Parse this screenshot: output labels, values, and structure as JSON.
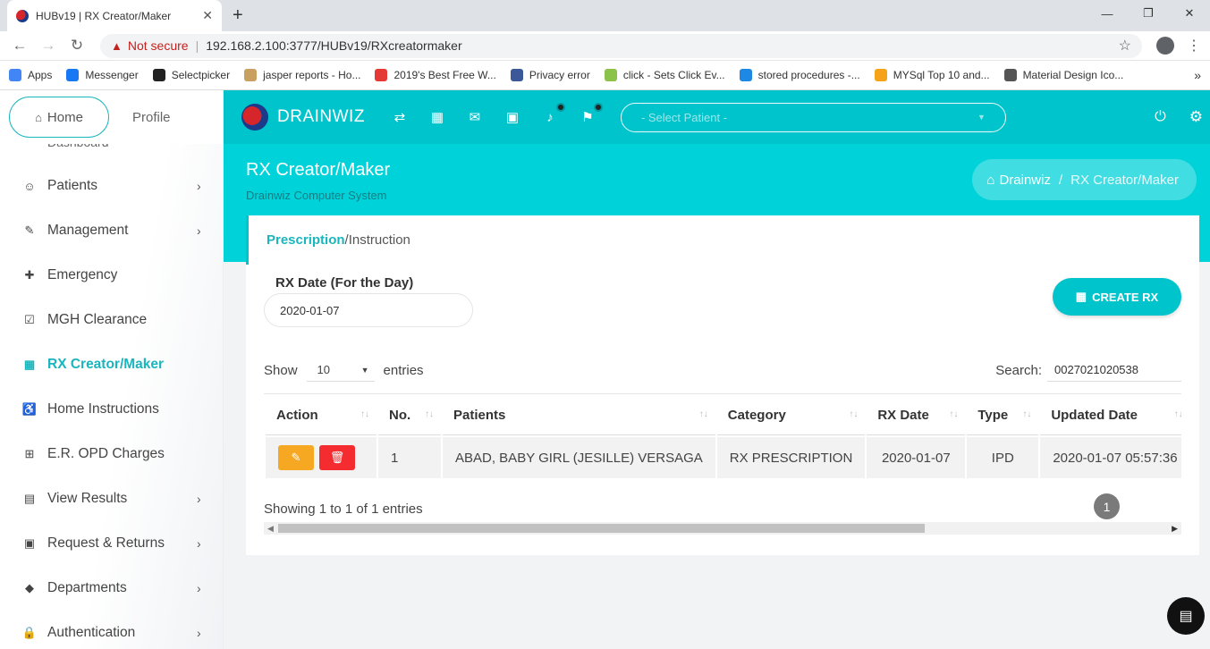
{
  "browser": {
    "tab_title": "HUBv19 | RX Creator/Maker",
    "tab_close": "✕",
    "new_tab": "+",
    "security_label": "Not secure",
    "url": "192.168.2.100:3777/HUBv19/RXcreatormaker",
    "bookmarks": [
      {
        "label": "Apps",
        "color": "#4285f4"
      },
      {
        "label": "Messenger",
        "color": "#1877f2"
      },
      {
        "label": "Selectpicker",
        "color": "#222222"
      },
      {
        "label": "jasper reports - Ho...",
        "color": "#c8a060"
      },
      {
        "label": "2019's Best Free W...",
        "color": "#e53935"
      },
      {
        "label": "Privacy error",
        "color": "#3b5998"
      },
      {
        "label": "click - Sets Click Ev...",
        "color": "#8bc34a"
      },
      {
        "label": "stored procedures -...",
        "color": "#1e88e5"
      },
      {
        "label": "MYSql Top 10 and...",
        "color": "#f4a31a"
      },
      {
        "label": "Material Design Ico...",
        "color": "#555555"
      }
    ],
    "bookmarks_more": "»"
  },
  "sidebar": {
    "home_tab": "Home",
    "profile_tab": "Profile",
    "cut_label": "Dashboard",
    "items": [
      {
        "label": "Patients",
        "icon": "☺",
        "chevron": "›",
        "active": false
      },
      {
        "label": "Management",
        "icon": "✎",
        "chevron": "›",
        "active": false
      },
      {
        "label": "Emergency",
        "icon": "✚",
        "chevron": "",
        "active": false
      },
      {
        "label": "MGH Clearance",
        "icon": "☑",
        "chevron": "",
        "active": false
      },
      {
        "label": "RX Creator/Maker",
        "icon": "▦",
        "chevron": "",
        "active": true
      },
      {
        "label": "Home Instructions",
        "icon": "♿",
        "chevron": "",
        "active": false
      },
      {
        "label": "E.R. OPD Charges",
        "icon": "⊞",
        "chevron": "",
        "active": false
      },
      {
        "label": "View Results",
        "icon": "▤",
        "chevron": "›",
        "active": false
      },
      {
        "label": "Request & Returns",
        "icon": "▣",
        "chevron": "›",
        "active": false
      },
      {
        "label": "Departments",
        "icon": "◆",
        "chevron": "›",
        "active": false
      },
      {
        "label": "Authentication",
        "icon": "🔒",
        "chevron": "›",
        "active": false
      }
    ]
  },
  "topnav": {
    "brand": "DRAINWIZ",
    "patient_select_placeholder": "- Select Patient -"
  },
  "header": {
    "title": "RX Creator/Maker",
    "subtitle": "Drainwiz Computer System",
    "breadcrumb_home": "Drainwiz",
    "breadcrumb_sep": "/",
    "breadcrumb_current": "RX Creator/Maker"
  },
  "card": {
    "heading_primary": "Prescription",
    "heading_secondary": "/Instruction",
    "rx_date_label": "RX Date (For the Day)",
    "rx_date_value": "2020-01-07",
    "create_button": "CREATE RX",
    "show_label": "Show",
    "entries_value": "10",
    "entries_label": "entries",
    "search_label": "Search:",
    "search_value": "0027021020538",
    "table": {
      "columns": [
        "Action",
        "No.",
        "Patients",
        "Category",
        "RX Date",
        "Type",
        "Updated Date"
      ],
      "rows": [
        {
          "no": "1",
          "patient": "ABAD, BABY GIRL (JESILLE) VERSAGA",
          "category": "RX PRESCRIPTION",
          "rx_date": "2020-01-07",
          "type": "IPD",
          "updated": "2020-01-07 05:57:36"
        }
      ]
    },
    "showing_text": "Showing 1 to 1 of 1 entries",
    "current_page": "1"
  },
  "colors": {
    "accent": "#00c4cc",
    "edit": "#f7a823",
    "delete": "#f42c30"
  }
}
